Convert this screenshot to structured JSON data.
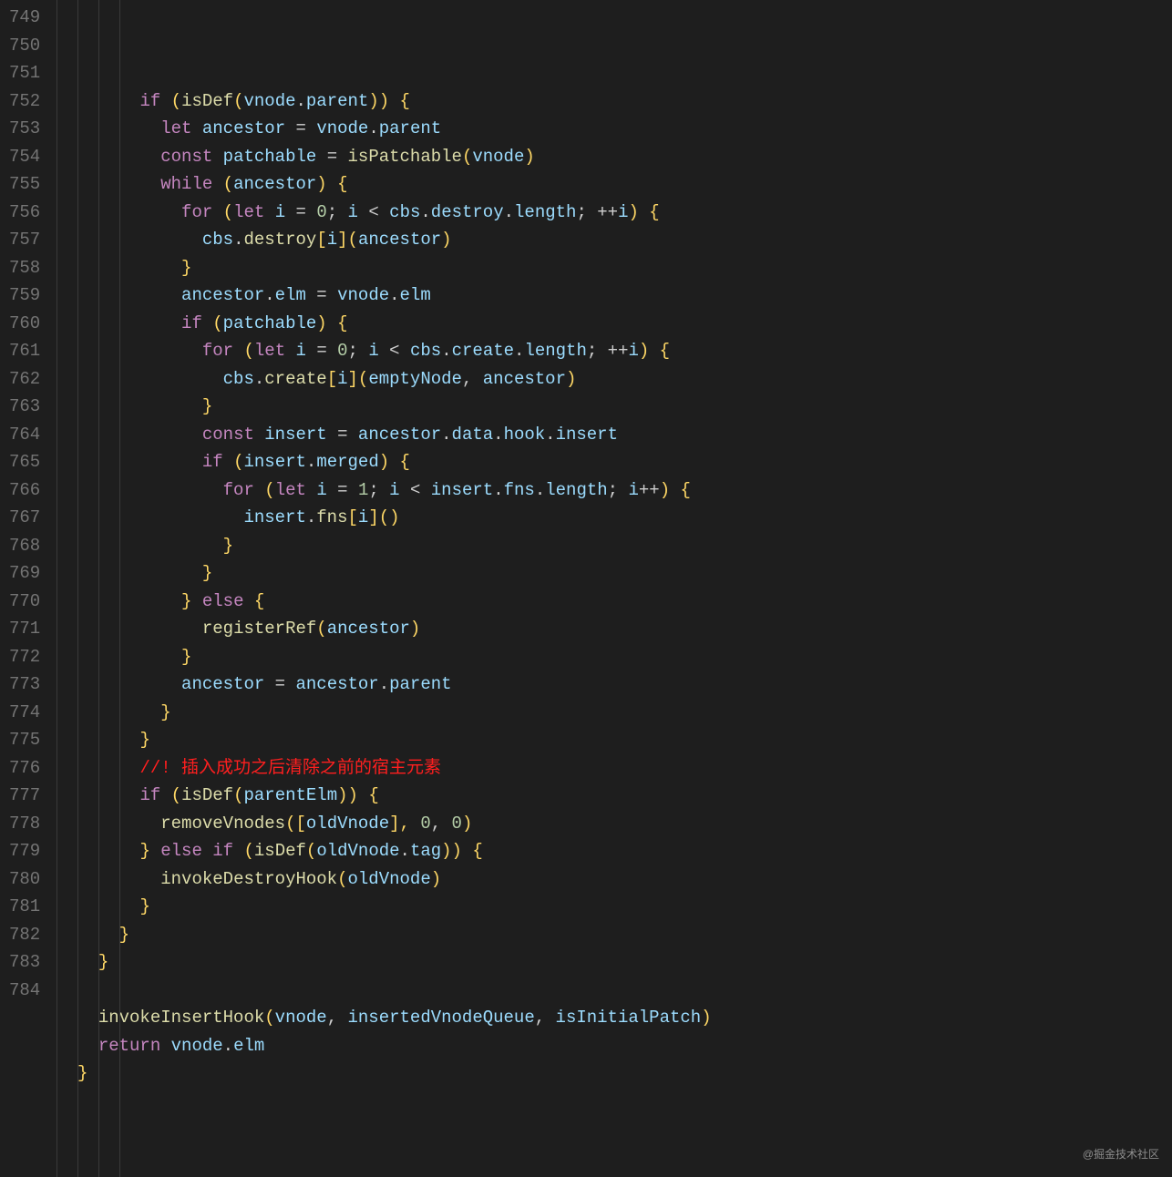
{
  "editor": {
    "first_line_number": 749,
    "indent_guide_cols": [
      0,
      2,
      4,
      6
    ],
    "lines": [
      {
        "n": 749,
        "tokens": [
          [
            "        ",
            "op"
          ],
          [
            "if",
            "kw"
          ],
          [
            " (",
            "pun"
          ],
          [
            "isDef",
            "fn"
          ],
          [
            "(",
            "pun"
          ],
          [
            "vnode",
            "var"
          ],
          [
            ".",
            "op"
          ],
          [
            "parent",
            "prop"
          ],
          [
            ")) {",
            "pun"
          ]
        ]
      },
      {
        "n": 750,
        "tokens": [
          [
            "          ",
            "op"
          ],
          [
            "let",
            "kw"
          ],
          [
            " ",
            "op"
          ],
          [
            "ancestor",
            "var"
          ],
          [
            " = ",
            "op"
          ],
          [
            "vnode",
            "var"
          ],
          [
            ".",
            "op"
          ],
          [
            "parent",
            "prop"
          ]
        ]
      },
      {
        "n": 751,
        "tokens": [
          [
            "          ",
            "op"
          ],
          [
            "const",
            "kw"
          ],
          [
            " ",
            "op"
          ],
          [
            "patchable",
            "var"
          ],
          [
            " = ",
            "op"
          ],
          [
            "isPatchable",
            "fn"
          ],
          [
            "(",
            "pun"
          ],
          [
            "vnode",
            "var"
          ],
          [
            ")",
            "pun"
          ]
        ]
      },
      {
        "n": 752,
        "tokens": [
          [
            "          ",
            "op"
          ],
          [
            "while",
            "kw"
          ],
          [
            " (",
            "pun"
          ],
          [
            "ancestor",
            "var"
          ],
          [
            ") {",
            "pun"
          ]
        ]
      },
      {
        "n": 753,
        "tokens": [
          [
            "            ",
            "op"
          ],
          [
            "for",
            "kw"
          ],
          [
            " (",
            "pun"
          ],
          [
            "let",
            "kw"
          ],
          [
            " ",
            "op"
          ],
          [
            "i",
            "var"
          ],
          [
            " = ",
            "op"
          ],
          [
            "0",
            "num"
          ],
          [
            "; ",
            "op"
          ],
          [
            "i",
            "var"
          ],
          [
            " < ",
            "op"
          ],
          [
            "cbs",
            "var"
          ],
          [
            ".",
            "op"
          ],
          [
            "destroy",
            "prop"
          ],
          [
            ".",
            "op"
          ],
          [
            "length",
            "prop"
          ],
          [
            "; ++",
            "op"
          ],
          [
            "i",
            "var"
          ],
          [
            ") {",
            "pun"
          ]
        ]
      },
      {
        "n": 754,
        "tokens": [
          [
            "              ",
            "op"
          ],
          [
            "cbs",
            "var"
          ],
          [
            ".",
            "op"
          ],
          [
            "destroy",
            "fn"
          ],
          [
            "[",
            "pun"
          ],
          [
            "i",
            "var"
          ],
          [
            "](",
            "pun"
          ],
          [
            "ancestor",
            "var"
          ],
          [
            ")",
            "pun"
          ]
        ]
      },
      {
        "n": 755,
        "tokens": [
          [
            "            ",
            "op"
          ],
          [
            "}",
            "pun"
          ]
        ]
      },
      {
        "n": 756,
        "tokens": [
          [
            "            ",
            "op"
          ],
          [
            "ancestor",
            "var"
          ],
          [
            ".",
            "op"
          ],
          [
            "elm",
            "prop"
          ],
          [
            " = ",
            "op"
          ],
          [
            "vnode",
            "var"
          ],
          [
            ".",
            "op"
          ],
          [
            "elm",
            "prop"
          ]
        ]
      },
      {
        "n": 757,
        "tokens": [
          [
            "            ",
            "op"
          ],
          [
            "if",
            "kw"
          ],
          [
            " (",
            "pun"
          ],
          [
            "patchable",
            "var"
          ],
          [
            ") {",
            "pun"
          ]
        ]
      },
      {
        "n": 758,
        "tokens": [
          [
            "              ",
            "op"
          ],
          [
            "for",
            "kw"
          ],
          [
            " (",
            "pun"
          ],
          [
            "let",
            "kw"
          ],
          [
            " ",
            "op"
          ],
          [
            "i",
            "var"
          ],
          [
            " = ",
            "op"
          ],
          [
            "0",
            "num"
          ],
          [
            "; ",
            "op"
          ],
          [
            "i",
            "var"
          ],
          [
            " < ",
            "op"
          ],
          [
            "cbs",
            "var"
          ],
          [
            ".",
            "op"
          ],
          [
            "create",
            "prop"
          ],
          [
            ".",
            "op"
          ],
          [
            "length",
            "prop"
          ],
          [
            "; ++",
            "op"
          ],
          [
            "i",
            "var"
          ],
          [
            ") {",
            "pun"
          ]
        ]
      },
      {
        "n": 759,
        "tokens": [
          [
            "                ",
            "op"
          ],
          [
            "cbs",
            "var"
          ],
          [
            ".",
            "op"
          ],
          [
            "create",
            "fn"
          ],
          [
            "[",
            "pun"
          ],
          [
            "i",
            "var"
          ],
          [
            "](",
            "pun"
          ],
          [
            "emptyNode",
            "var"
          ],
          [
            ", ",
            "op"
          ],
          [
            "ancestor",
            "var"
          ],
          [
            ")",
            "pun"
          ]
        ]
      },
      {
        "n": 760,
        "tokens": [
          [
            "              ",
            "op"
          ],
          [
            "}",
            "pun"
          ]
        ]
      },
      {
        "n": 761,
        "tokens": [
          [
            "              ",
            "op"
          ],
          [
            "const",
            "kw"
          ],
          [
            " ",
            "op"
          ],
          [
            "insert",
            "var"
          ],
          [
            " = ",
            "op"
          ],
          [
            "ancestor",
            "var"
          ],
          [
            ".",
            "op"
          ],
          [
            "data",
            "prop"
          ],
          [
            ".",
            "op"
          ],
          [
            "hook",
            "prop"
          ],
          [
            ".",
            "op"
          ],
          [
            "insert",
            "prop"
          ]
        ]
      },
      {
        "n": 762,
        "tokens": [
          [
            "              ",
            "op"
          ],
          [
            "if",
            "kw"
          ],
          [
            " (",
            "pun"
          ],
          [
            "insert",
            "var"
          ],
          [
            ".",
            "op"
          ],
          [
            "merged",
            "prop"
          ],
          [
            ") {",
            "pun"
          ]
        ]
      },
      {
        "n": 763,
        "tokens": [
          [
            "                ",
            "op"
          ],
          [
            "for",
            "kw"
          ],
          [
            " (",
            "pun"
          ],
          [
            "let",
            "kw"
          ],
          [
            " ",
            "op"
          ],
          [
            "i",
            "var"
          ],
          [
            " = ",
            "op"
          ],
          [
            "1",
            "num"
          ],
          [
            "; ",
            "op"
          ],
          [
            "i",
            "var"
          ],
          [
            " < ",
            "op"
          ],
          [
            "insert",
            "var"
          ],
          [
            ".",
            "op"
          ],
          [
            "fns",
            "prop"
          ],
          [
            ".",
            "op"
          ],
          [
            "length",
            "prop"
          ],
          [
            "; ",
            "op"
          ],
          [
            "i",
            "var"
          ],
          [
            "++",
            "op"
          ],
          [
            ") {",
            "pun"
          ]
        ]
      },
      {
        "n": 764,
        "tokens": [
          [
            "                  ",
            "op"
          ],
          [
            "insert",
            "var"
          ],
          [
            ".",
            "op"
          ],
          [
            "fns",
            "fn"
          ],
          [
            "[",
            "pun"
          ],
          [
            "i",
            "var"
          ],
          [
            "]()",
            "pun"
          ]
        ]
      },
      {
        "n": 765,
        "tokens": [
          [
            "                ",
            "op"
          ],
          [
            "}",
            "pun"
          ]
        ]
      },
      {
        "n": 766,
        "tokens": [
          [
            "              ",
            "op"
          ],
          [
            "}",
            "pun"
          ]
        ]
      },
      {
        "n": 767,
        "tokens": [
          [
            "            ",
            "op"
          ],
          [
            "}",
            "pun"
          ],
          [
            " ",
            "op"
          ],
          [
            "else",
            "kw"
          ],
          [
            " {",
            "pun"
          ]
        ]
      },
      {
        "n": 768,
        "tokens": [
          [
            "              ",
            "op"
          ],
          [
            "registerRef",
            "fn"
          ],
          [
            "(",
            "pun"
          ],
          [
            "ancestor",
            "var"
          ],
          [
            ")",
            "pun"
          ]
        ]
      },
      {
        "n": 769,
        "tokens": [
          [
            "            ",
            "op"
          ],
          [
            "}",
            "pun"
          ]
        ]
      },
      {
        "n": 770,
        "tokens": [
          [
            "            ",
            "op"
          ],
          [
            "ancestor",
            "var"
          ],
          [
            " = ",
            "op"
          ],
          [
            "ancestor",
            "var"
          ],
          [
            ".",
            "op"
          ],
          [
            "parent",
            "prop"
          ]
        ]
      },
      {
        "n": 771,
        "tokens": [
          [
            "          ",
            "op"
          ],
          [
            "}",
            "pun"
          ]
        ]
      },
      {
        "n": 772,
        "tokens": [
          [
            "        ",
            "op"
          ],
          [
            "}",
            "pun"
          ]
        ]
      },
      {
        "n": 773,
        "tokens": [
          [
            "        ",
            "op"
          ],
          [
            "//! 插入成功之后清除之前的宿主元素",
            "cmt"
          ]
        ]
      },
      {
        "n": 774,
        "tokens": [
          [
            "        ",
            "op"
          ],
          [
            "if",
            "kw"
          ],
          [
            " (",
            "pun"
          ],
          [
            "isDef",
            "fn"
          ],
          [
            "(",
            "pun"
          ],
          [
            "parentElm",
            "var"
          ],
          [
            ")) {",
            "pun"
          ]
        ]
      },
      {
        "n": 775,
        "tokens": [
          [
            "          ",
            "op"
          ],
          [
            "removeVnodes",
            "fn"
          ],
          [
            "([",
            "pun"
          ],
          [
            "oldVnode",
            "var"
          ],
          [
            "], ",
            "pun"
          ],
          [
            "0",
            "num"
          ],
          [
            ", ",
            "op"
          ],
          [
            "0",
            "num"
          ],
          [
            ")",
            "pun"
          ]
        ]
      },
      {
        "n": 776,
        "tokens": [
          [
            "        ",
            "op"
          ],
          [
            "}",
            "pun"
          ],
          [
            " ",
            "op"
          ],
          [
            "else",
            "kw"
          ],
          [
            " ",
            "op"
          ],
          [
            "if",
            "kw"
          ],
          [
            " (",
            "pun"
          ],
          [
            "isDef",
            "fn"
          ],
          [
            "(",
            "pun"
          ],
          [
            "oldVnode",
            "var"
          ],
          [
            ".",
            "op"
          ],
          [
            "tag",
            "prop"
          ],
          [
            ")) {",
            "pun"
          ]
        ]
      },
      {
        "n": 777,
        "tokens": [
          [
            "          ",
            "op"
          ],
          [
            "invokeDestroyHook",
            "fn"
          ],
          [
            "(",
            "pun"
          ],
          [
            "oldVnode",
            "var"
          ],
          [
            ")",
            "pun"
          ]
        ]
      },
      {
        "n": 778,
        "tokens": [
          [
            "        ",
            "op"
          ],
          [
            "}",
            "pun"
          ]
        ]
      },
      {
        "n": 779,
        "tokens": [
          [
            "      ",
            "op"
          ],
          [
            "}",
            "pun"
          ]
        ]
      },
      {
        "n": 780,
        "tokens": [
          [
            "    ",
            "op"
          ],
          [
            "}",
            "pun"
          ]
        ]
      },
      {
        "n": 781,
        "tokens": [
          [
            "",
            "op"
          ]
        ]
      },
      {
        "n": 782,
        "tokens": [
          [
            "    ",
            "op"
          ],
          [
            "invokeInsertHook",
            "fn"
          ],
          [
            "(",
            "pun"
          ],
          [
            "vnode",
            "var"
          ],
          [
            ", ",
            "op"
          ],
          [
            "insertedVnodeQueue",
            "var"
          ],
          [
            ", ",
            "op"
          ],
          [
            "isInitialPatch",
            "var"
          ],
          [
            ")",
            "pun"
          ]
        ]
      },
      {
        "n": 783,
        "tokens": [
          [
            "    ",
            "op"
          ],
          [
            "return",
            "kw"
          ],
          [
            " ",
            "op"
          ],
          [
            "vnode",
            "var"
          ],
          [
            ".",
            "op"
          ],
          [
            "elm",
            "prop"
          ]
        ]
      },
      {
        "n": 784,
        "tokens": [
          [
            "  ",
            "op"
          ],
          [
            "}",
            "pun"
          ]
        ]
      }
    ]
  },
  "watermark": "@掘金技术社区"
}
